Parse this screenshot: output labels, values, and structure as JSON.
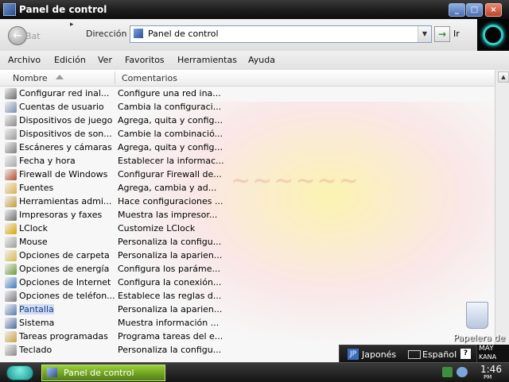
{
  "window": {
    "title": "Panel de control"
  },
  "toolbar": {
    "back_label": "Bat"
  },
  "address": {
    "label": "Dirección",
    "value": "Panel de control",
    "go_label": "Ir"
  },
  "menu": [
    "Archivo",
    "Edición",
    "Ver",
    "Favoritos",
    "Herramientas",
    "Ayuda"
  ],
  "columns": {
    "name": "Nombre",
    "comments": "Comentarios"
  },
  "items": [
    {
      "name": "Configurar red inal...",
      "desc": "Configure una red ina...",
      "icon": "wireless-network-icon",
      "color": "#6a6a6a"
    },
    {
      "name": "Cuentas de usuario",
      "desc": "Cambia la configuraci...",
      "icon": "user-accounts-icon",
      "color": "#7a8fb0"
    },
    {
      "name": "Dispositivos de juego",
      "desc": "Agrega, quita y config...",
      "icon": "game-controller-icon",
      "color": "#8a8a8a"
    },
    {
      "name": "Dispositivos de son...",
      "desc": "Cambie la combinació...",
      "icon": "sound-icon",
      "color": "#9a9a9a"
    },
    {
      "name": "Escáneres y cámaras",
      "desc": "Agrega, quita y config...",
      "icon": "scanner-camera-icon",
      "color": "#7d7d7d"
    },
    {
      "name": "Fecha y hora",
      "desc": "Establecer la informac...",
      "icon": "clock-icon",
      "color": "#a8a8a8"
    },
    {
      "name": "Firewall de Windows",
      "desc": "Configurar Firewall de...",
      "icon": "firewall-icon",
      "color": "#b04a2a"
    },
    {
      "name": "Fuentes",
      "desc": "Agrega, cambia y ad...",
      "icon": "fonts-folder-icon",
      "color": "#d9b14a"
    },
    {
      "name": "Herramientas admi...",
      "desc": "Hace configuraciones ...",
      "icon": "admin-tools-icon",
      "color": "#c49a3a"
    },
    {
      "name": "Impresoras y faxes",
      "desc": "Muestra las impresor...",
      "icon": "printer-icon",
      "color": "#6d6d6d"
    },
    {
      "name": "LClock",
      "desc": "Customize LClock",
      "icon": "lclock-icon",
      "color": "#d9a400"
    },
    {
      "name": "Mouse",
      "desc": "Personaliza la configu...",
      "icon": "mouse-icon",
      "color": "#9c9c9c"
    },
    {
      "name": "Opciones de carpeta",
      "desc": "Personaliza la aparien...",
      "icon": "folder-options-icon",
      "color": "#d6b84a"
    },
    {
      "name": "Opciones de energía",
      "desc": "Configura los paráme...",
      "icon": "power-options-icon",
      "color": "#6a9a3a"
    },
    {
      "name": "Opciones de Internet",
      "desc": "Configura la conexión...",
      "icon": "internet-options-icon",
      "color": "#3a7ac0"
    },
    {
      "name": "Opciones de teléfon...",
      "desc": "Establece las reglas d...",
      "icon": "phone-modem-icon",
      "color": "#7a7a7a"
    },
    {
      "name": "Pantalla",
      "desc": "Personaliza la aparien...",
      "icon": "display-icon",
      "color": "#5a7ab0",
      "selected": true
    },
    {
      "name": "Sistema",
      "desc": "Muestra información ...",
      "icon": "system-icon",
      "color": "#4a6aa0"
    },
    {
      "name": "Tareas programadas",
      "desc": "Programa tareas del e...",
      "icon": "scheduled-tasks-icon",
      "color": "#c8a040"
    },
    {
      "name": "Teclado",
      "desc": "Personaliza la configu...",
      "icon": "keyboard-icon",
      "color": "#8a8a8a"
    }
  ],
  "desktop": {
    "recycle_bin_label": "Papelera de"
  },
  "language_bar": {
    "input1": "Japonés",
    "input2": "Español",
    "ime_line1": "MAY",
    "ime_line2": "KANA"
  },
  "taskbar": {
    "task_label": "Panel de control",
    "clock": "1:46",
    "clock_suffix": "PM"
  }
}
